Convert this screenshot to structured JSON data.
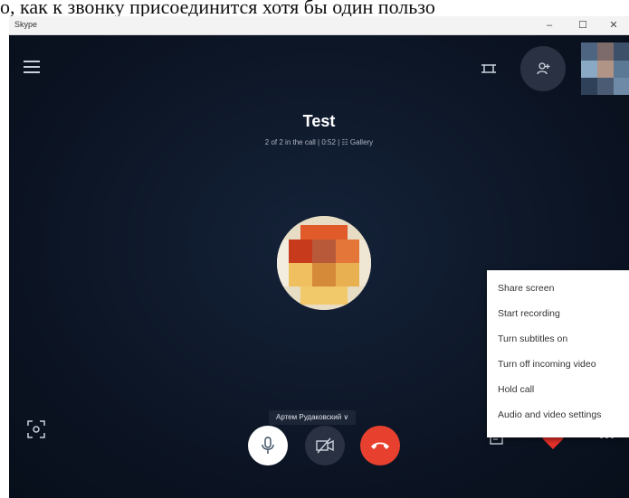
{
  "caption": {
    "text": "о, как к звонку присоединится хотя бы один пользо"
  },
  "window": {
    "title": "Skype",
    "controls": {
      "minimize": "–",
      "maximize": "☐",
      "close": "✕"
    }
  },
  "call": {
    "title": "Test",
    "subtitle": "2 of 2 in the call | 0:52  |  ☷ Gallery",
    "participant_name": "Артем Рудаковский ∨"
  },
  "icons": {
    "menu": "hamburger-icon",
    "layout": "fullscreen-icon",
    "add_person": "add-person-icon",
    "camera_switch": "camera-frame-icon",
    "mic": "microphone-icon",
    "video_off": "video-off-icon",
    "hangup": "hang-up-icon",
    "chat": "chat-icon",
    "heart": "heart-icon",
    "more": "more-icon"
  },
  "menu": {
    "items": [
      "Share screen",
      "Start recording",
      "Turn subtitles on",
      "Turn off incoming video",
      "Hold call",
      "Audio and video settings"
    ]
  },
  "colors": {
    "background": "#0d1626",
    "hangup": "#e8402f",
    "heart": "#e8302a",
    "mic_button": "#ffffff",
    "video_button": "#2a3142"
  }
}
